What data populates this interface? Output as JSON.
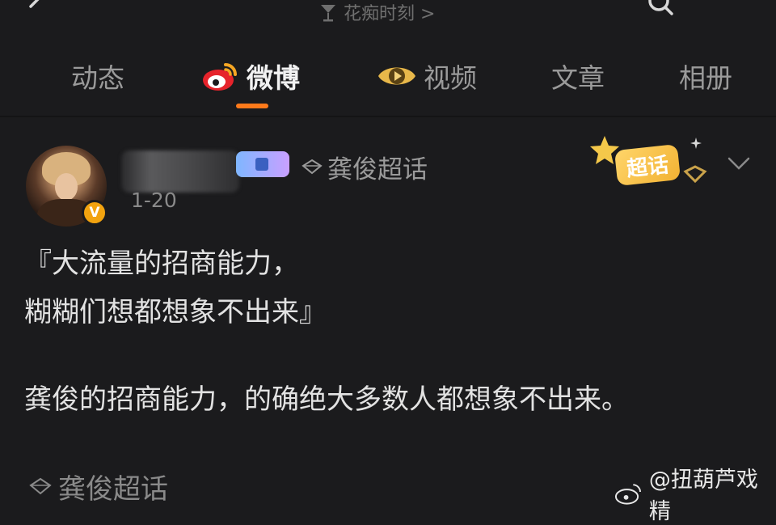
{
  "header": {
    "title": "花痴时刻 >"
  },
  "tabs": [
    {
      "label": "动态",
      "icon": null
    },
    {
      "label": "微博",
      "icon": "weibo-icon"
    },
    {
      "label": "视频",
      "icon": "video-icon"
    },
    {
      "label": "文章",
      "icon": null
    },
    {
      "label": "相册",
      "icon": null
    }
  ],
  "active_tab": "微博",
  "post": {
    "topic": "龚俊超话",
    "time": "1-20",
    "badge_label": "超话",
    "lines": [
      "『大流量的招商能力，",
      "糊糊们想都想象不出来』",
      "龚俊的招商能力，的确绝大多数人都想象不出来。"
    ],
    "footer_topic": "龚俊超话"
  },
  "watermark": "@扭葫芦戏精",
  "colors": {
    "accent": "#ff7a1a",
    "background": "#1b1b1d",
    "verified": "#f2a30f",
    "badge": "#f2b233"
  }
}
